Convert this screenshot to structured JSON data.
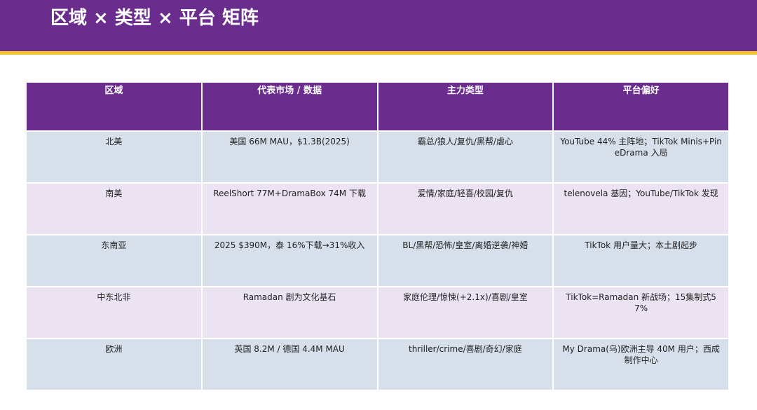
{
  "slide": {
    "title": "区域 × 类型 × 平台 矩阵"
  },
  "colors": {
    "header_bg": "#6a2d8e",
    "header_stripe": "#f2c12e",
    "row_odd": "#d7dfea",
    "row_even": "#ebe2f2"
  },
  "table": {
    "headers": [
      "区域",
      "代表市场 / 数据",
      "主力类型",
      "平台偏好"
    ],
    "rows": [
      [
        "北美",
        "美国 66M MAU，$1.3B(2025)",
        "霸总/狼人/复仇/黑帮/虐心",
        "YouTube 44% 主阵地；TikTok Minis+PineDrama 入局"
      ],
      [
        "南美",
        "ReelShort 77M+DramaBox 74M 下载",
        "爱情/家庭/轻喜/校园/复仇",
        "telenovela 基因；YouTube/TikTok 发现"
      ],
      [
        "东南亚",
        "2025 $390M，泰 16%下载→31%收入",
        "BL/黑帮/恐怖/皇室/离婚逆袭/神婚",
        "TikTok 用户量大；本土剧起步"
      ],
      [
        "中东北非",
        "Ramadan 剧为文化基石",
        "家庭伦理/惊悚(+2.1x)/喜剧/皇室",
        "TikTok=Ramadan 新战场；15集制式57%"
      ],
      [
        "欧洲",
        "英国 8.2M / 德国 4.4M MAU",
        "thriller/crime/喜剧/奇幻/家庭",
        "My Drama(乌)欧洲主导 40M 用户；西成制作中心"
      ]
    ]
  }
}
